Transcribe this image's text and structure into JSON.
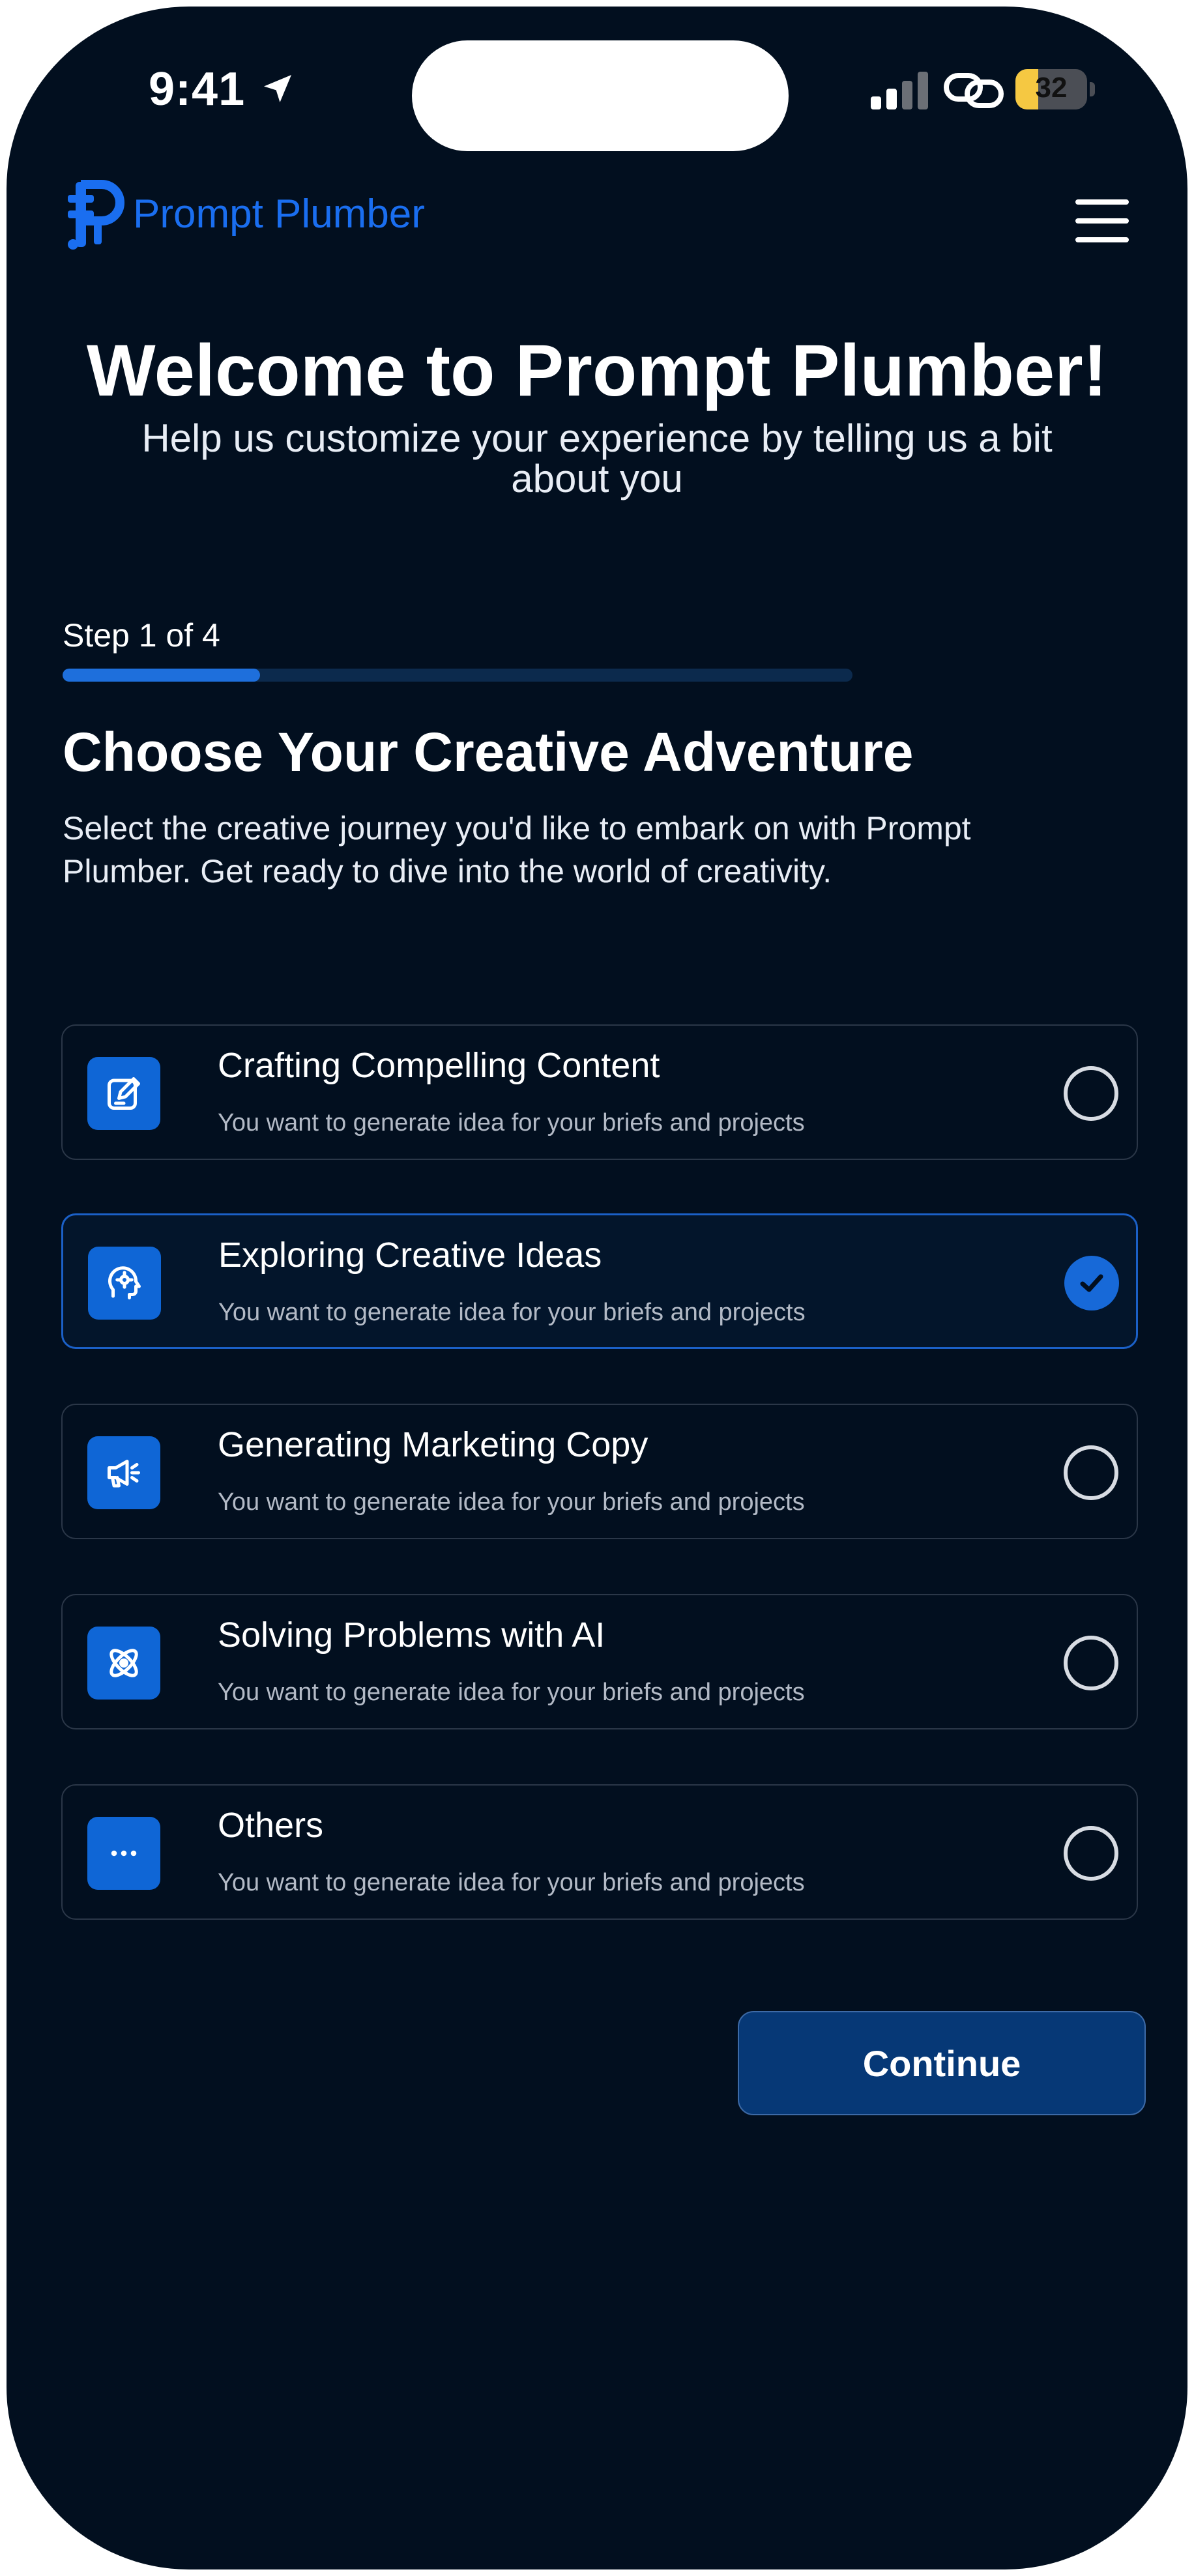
{
  "status_bar": {
    "time": "9:41",
    "battery": "32",
    "battery_level": 0.32,
    "icons": [
      "location-arrow-icon",
      "cellular-signal-icon",
      "link-icon",
      "battery-icon"
    ]
  },
  "header": {
    "brand": "Prompt Plumber",
    "menu_icon": "hamburger-menu-icon"
  },
  "welcome": {
    "title": "Welcome to Prompt Plumber!",
    "subtitle": "Help us customize your experience by telling us a bit about you"
  },
  "step": {
    "label": "Step 1 of 4",
    "current": 1,
    "total": 4
  },
  "section": {
    "title": "Choose Your Creative Adventure",
    "description": "Select the creative journey you'd like to embark on with Prompt Plumber. Get ready to dive into the world of creativity."
  },
  "options": [
    {
      "title": "Crafting Compelling Content",
      "description": "You want to generate idea for your briefs and projects",
      "icon": "edit-note-icon",
      "selected": false
    },
    {
      "title": "Exploring Creative Ideas",
      "description": "You want to generate idea for your briefs and projects",
      "icon": "head-gear-icon",
      "selected": true
    },
    {
      "title": "Generating Marketing Copy",
      "description": "You want to generate idea for your briefs and projects",
      "icon": "megaphone-icon",
      "selected": false
    },
    {
      "title": "Solving Problems with AI",
      "description": "You want to generate idea for your briefs and projects",
      "icon": "atom-icon",
      "selected": false
    },
    {
      "title": "Others",
      "description": "You want to generate idea for your briefs and projects",
      "icon": "more-dots-icon",
      "selected": false
    }
  ],
  "actions": {
    "continue_label": "Continue"
  },
  "colors": {
    "background": "#020f1f",
    "accent": "#1769d8",
    "brand_text": "#1a6ef0",
    "button": "#063876"
  }
}
